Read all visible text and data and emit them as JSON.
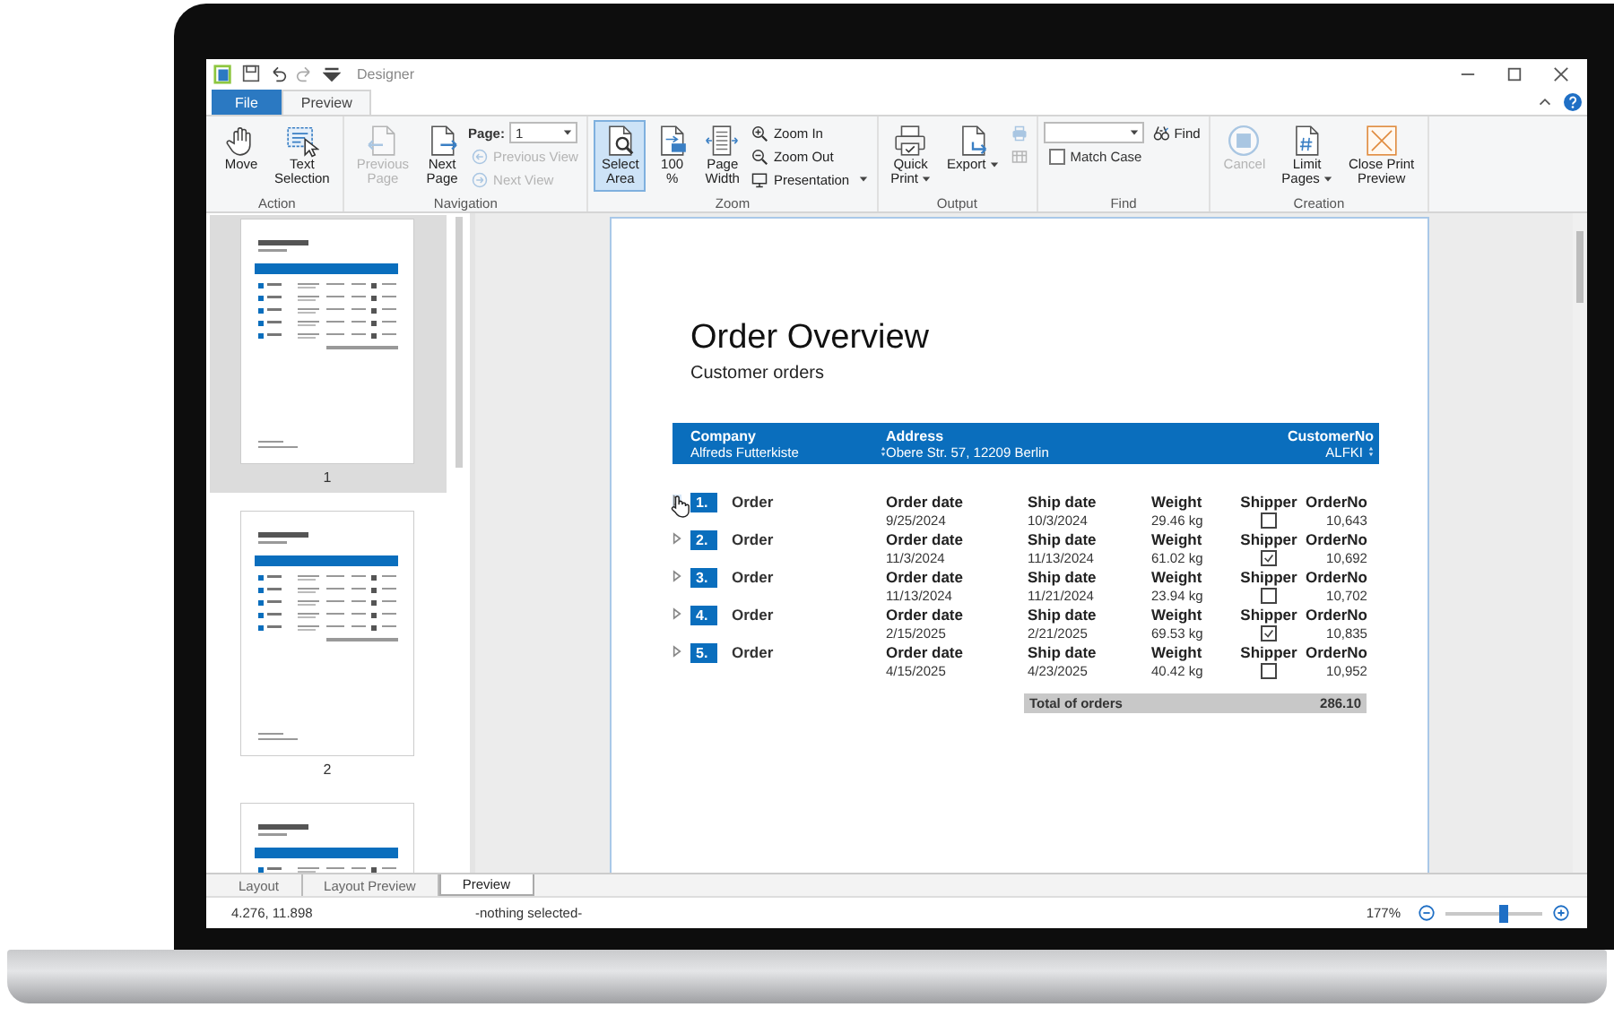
{
  "window": {
    "title": "Designer"
  },
  "ribbon_tabs": [
    {
      "label": "File",
      "kind": "file",
      "selected": false
    },
    {
      "label": "Preview",
      "kind": "tab",
      "selected": true
    }
  ],
  "ribbon_groups": [
    {
      "label": "Action",
      "items": [
        {
          "kind": "large",
          "label_lines": [
            "Move"
          ],
          "disabled": false,
          "active": false
        },
        {
          "kind": "large",
          "label_lines": [
            "Text",
            "Selection"
          ],
          "disabled": false,
          "active": false
        }
      ]
    },
    {
      "label": "Navigation",
      "items": [
        {
          "kind": "large",
          "label_lines": [
            "Previous",
            "Page"
          ],
          "disabled": true,
          "active": false
        },
        {
          "kind": "large",
          "label_lines": [
            "Next",
            "Page"
          ],
          "disabled": false,
          "active": false
        },
        {
          "kind": "stack",
          "rows": [
            [
              {
                "kind": "combo",
                "label": "Page:",
                "value": "1"
              }
            ],
            [
              {
                "kind": "small",
                "label": "Previous View",
                "disabled": true
              }
            ],
            [
              {
                "kind": "small",
                "label": "Next View",
                "disabled": true
              }
            ]
          ]
        }
      ]
    },
    {
      "label": "Zoom",
      "items": [
        {
          "kind": "large",
          "label_lines": [
            "Select",
            "Area"
          ],
          "disabled": false,
          "active": true
        },
        {
          "kind": "large",
          "label_lines": [
            "100",
            "%"
          ],
          "disabled": false,
          "active": false
        },
        {
          "kind": "large",
          "label_lines": [
            "Page",
            "Width"
          ],
          "disabled": false,
          "active": false
        },
        {
          "kind": "stack",
          "rows": [
            [
              {
                "kind": "small",
                "label": "Zoom In",
                "disabled": false
              }
            ],
            [
              {
                "kind": "small",
                "label": "Zoom Out",
                "disabled": false
              }
            ],
            [
              {
                "kind": "small",
                "label": "Presentation",
                "disabled": false,
                "dropdown": true
              }
            ]
          ]
        }
      ]
    },
    {
      "label": "Output",
      "items": [
        {
          "kind": "large",
          "label_lines": [
            "Quick",
            "Print"
          ],
          "disabled": false,
          "active": false,
          "dropdown": true
        },
        {
          "kind": "large",
          "label_lines": [
            "Export"
          ],
          "disabled": false,
          "active": false,
          "dropdown": true
        },
        {
          "kind": "stack",
          "rows": [
            [
              {
                "kind": "icon",
                "disabled": true
              }
            ],
            [
              {
                "kind": "icon",
                "disabled": true
              }
            ]
          ]
        }
      ]
    },
    {
      "label": "Find",
      "items": [
        {
          "kind": "stack",
          "rows": [
            [
              {
                "kind": "combo"
              },
              {
                "kind": "small",
                "label": "Find",
                "disabled": false
              }
            ],
            [
              {
                "kind": "checkbox",
                "label": "Match Case",
                "checked": false
              }
            ]
          ]
        }
      ]
    },
    {
      "label": "Creation",
      "items": [
        {
          "kind": "large",
          "label_lines": [
            "Cancel"
          ],
          "disabled": true,
          "active": false
        },
        {
          "kind": "large",
          "label_lines": [
            "Limit",
            "Pages"
          ],
          "disabled": false,
          "active": false,
          "dropdown": true
        },
        {
          "kind": "large",
          "label_lines": [
            "Close Print",
            "Preview"
          ],
          "disabled": false,
          "active": false
        }
      ]
    }
  ],
  "thumbnails": [
    {
      "label": "1",
      "selected": true
    },
    {
      "label": "2",
      "selected": false
    },
    {
      "selected": false
    }
  ],
  "report": {
    "title": "Order Overview",
    "subtitle": "Customer orders",
    "header": [
      {
        "label": "Company",
        "value": "Alfreds Futterkiste",
        "sortable": true
      },
      {
        "label": "Address",
        "value": "Obere Str. 57, 12209 Berlin",
        "sortable": false
      },
      {
        "label": "CustomerNo",
        "value": "ALFKI",
        "sortable": true
      }
    ],
    "orders": [
      {
        "number": "1.",
        "title": "Order",
        "hovered": true,
        "fields": [
          {
            "kind": "text",
            "label": "Order date",
            "value": "9/25/2024"
          },
          {
            "kind": "text",
            "label": "Ship date",
            "value": "10/3/2024"
          },
          {
            "kind": "text",
            "label": "Weight",
            "value": "29.46 kg"
          },
          {
            "kind": "checkbox",
            "label": "Shipper",
            "checked": false
          },
          {
            "kind": "number",
            "label": "OrderNo",
            "value": "10,643"
          }
        ]
      },
      {
        "number": "2.",
        "title": "Order",
        "hovered": false,
        "fields": [
          {
            "kind": "text",
            "label": "Order date",
            "value": "11/3/2024"
          },
          {
            "kind": "text",
            "label": "Ship date",
            "value": "11/13/2024"
          },
          {
            "kind": "text",
            "label": "Weight",
            "value": "61.02 kg"
          },
          {
            "kind": "checkbox",
            "label": "Shipper",
            "checked": true
          },
          {
            "kind": "number",
            "label": "OrderNo",
            "value": "10,692"
          }
        ]
      },
      {
        "number": "3.",
        "title": "Order",
        "hovered": false,
        "fields": [
          {
            "kind": "text",
            "label": "Order date",
            "value": "11/13/2024"
          },
          {
            "kind": "text",
            "label": "Ship date",
            "value": "11/21/2024"
          },
          {
            "kind": "text",
            "label": "Weight",
            "value": "23.94 kg"
          },
          {
            "kind": "checkbox",
            "label": "Shipper",
            "checked": false
          },
          {
            "kind": "number",
            "label": "OrderNo",
            "value": "10,702"
          }
        ]
      },
      {
        "number": "4.",
        "title": "Order",
        "hovered": false,
        "fields": [
          {
            "kind": "text",
            "label": "Order date",
            "value": "2/15/2025"
          },
          {
            "kind": "text",
            "label": "Ship date",
            "value": "2/21/2025"
          },
          {
            "kind": "text",
            "label": "Weight",
            "value": "69.53 kg"
          },
          {
            "kind": "checkbox",
            "label": "Shipper",
            "checked": true
          },
          {
            "kind": "number",
            "label": "OrderNo",
            "value": "10,835"
          }
        ]
      },
      {
        "number": "5.",
        "title": "Order",
        "hovered": false,
        "fields": [
          {
            "kind": "text",
            "label": "Order date",
            "value": "4/15/2025"
          },
          {
            "kind": "text",
            "label": "Ship date",
            "value": "4/23/2025"
          },
          {
            "kind": "text",
            "label": "Weight",
            "value": "40.42 kg"
          },
          {
            "kind": "checkbox",
            "label": "Shipper",
            "checked": false
          },
          {
            "kind": "number",
            "label": "OrderNo",
            "value": "10,952"
          }
        ]
      }
    ],
    "total": {
      "label": "Total of orders",
      "value": "286.10"
    }
  },
  "view_tabs": [
    {
      "label": "Layout",
      "selected": false
    },
    {
      "label": "Layout Preview",
      "selected": false
    },
    {
      "label": "Preview",
      "selected": true
    }
  ],
  "status_bar": {
    "position": "4.276, 11.898",
    "selection": "-nothing selected-",
    "zoom": "177%",
    "zoom_slider": {
      "level": 0.6
    }
  }
}
